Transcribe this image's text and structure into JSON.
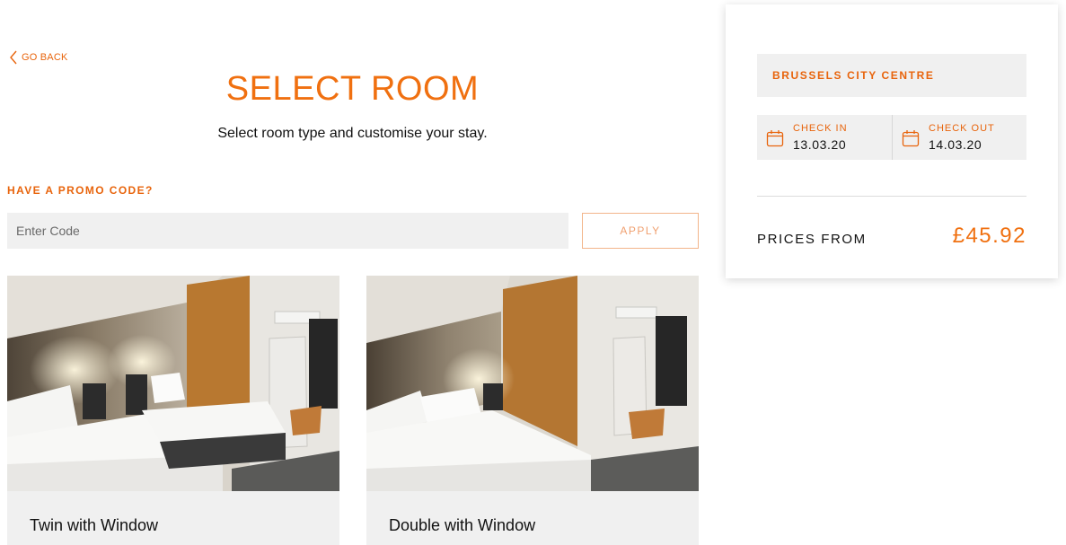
{
  "nav": {
    "go_back_label": "GO BACK"
  },
  "header": {
    "title": "SELECT ROOM",
    "subtitle": "Select room type and customise your stay."
  },
  "promo": {
    "label": "HAVE A PROMO CODE?",
    "input_value": "",
    "placeholder": "Enter Code",
    "apply_label": "APPLY"
  },
  "rooms": [
    {
      "name": "Twin with Window"
    },
    {
      "name": "Double with Window"
    }
  ],
  "booking": {
    "location": "BRUSSELS CITY CENTRE",
    "check_in_label": "CHECK IN",
    "check_in_value": "13.03.20",
    "check_out_label": "CHECK OUT",
    "check_out_value": "14.03.20",
    "prices_from_label": "PRICES FROM",
    "price": "£45.92"
  },
  "colors": {
    "accent": "#f07010",
    "field_bg": "#f0f0f0",
    "text": "#111111"
  },
  "icons": {
    "back": "chevron-left-icon",
    "calendar": "calendar-icon"
  }
}
